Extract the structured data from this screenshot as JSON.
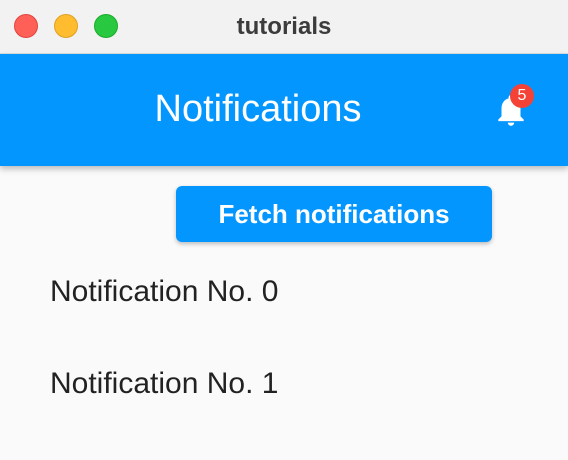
{
  "window": {
    "title": "tutorials"
  },
  "appbar": {
    "title": "Notifications",
    "badge_count": "5"
  },
  "actions": {
    "fetch_label": "Fetch notifications"
  },
  "notifications": [
    {
      "label": "Notification No. 0"
    },
    {
      "label": "Notification No. 1"
    }
  ],
  "colors": {
    "primary": "#0496ff",
    "badge": "#f44336",
    "close": "#fe5f57",
    "minimize": "#febc2e",
    "maximize": "#28c840"
  },
  "icons": {
    "notifications": "bell-icon"
  }
}
